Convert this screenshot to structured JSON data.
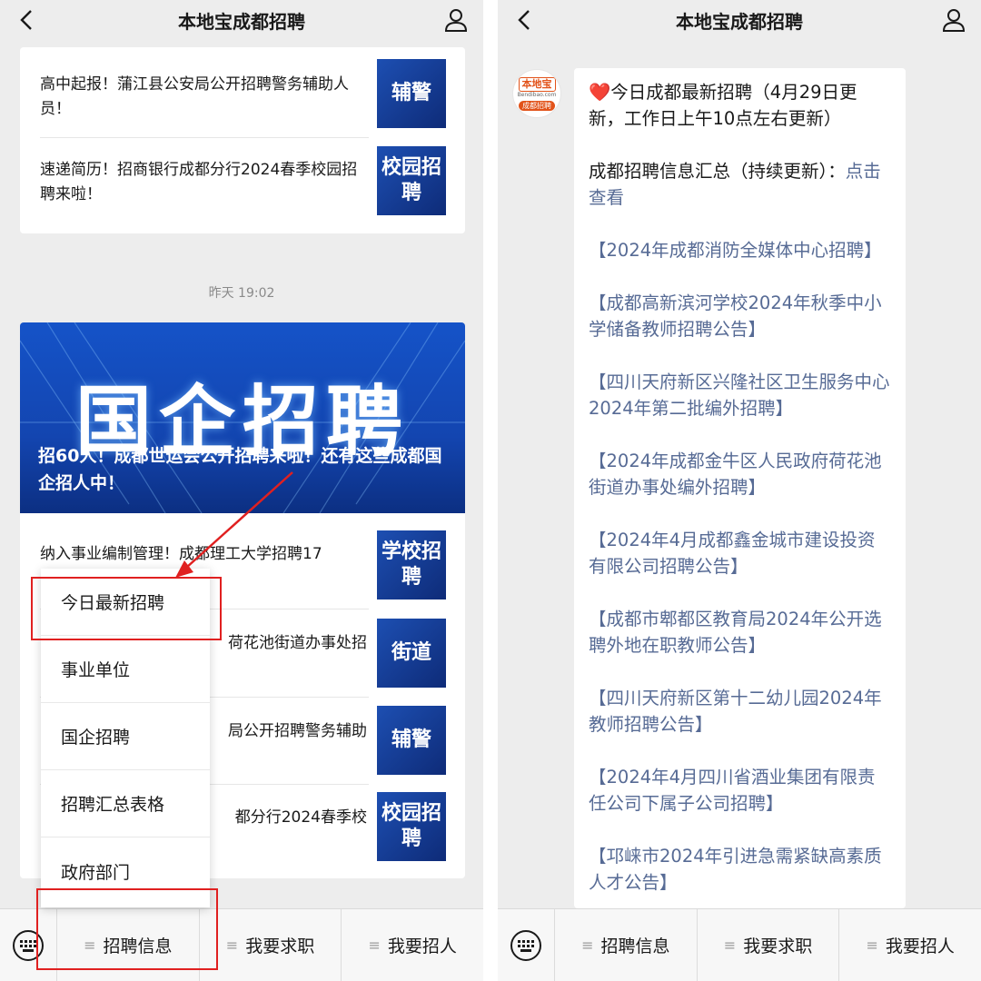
{
  "nav": {
    "title": "本地宝成都招聘"
  },
  "left": {
    "top_items": [
      {
        "text": "高中起报！蒲江县公安局公开招聘警务辅助人员！",
        "thumb": "辅警"
      },
      {
        "text": "速递简历！招商银行成都分行2024春季校园招聘来啦！",
        "thumb": "校园招聘"
      }
    ],
    "timestamp": "昨天 19:02",
    "banner": {
      "big_text": "国企招聘",
      "caption": "招60人！成都世运会公开招聘来啦！还有这些成都国企招人中！"
    },
    "list_items": [
      {
        "text": "纳入事业编制管理！成都理工大学招聘17",
        "thumb": "学校招聘"
      },
      {
        "text": "荷花池街道办事处招",
        "thumb": "街道"
      },
      {
        "text": "局公开招聘警务辅助",
        "thumb": "辅警"
      },
      {
        "text": "都分行2024春季校",
        "thumb": "校园招聘"
      }
    ],
    "popup": [
      "今日最新招聘",
      "事业单位",
      "国企招聘",
      "招聘汇总表格",
      "政府部门"
    ]
  },
  "bottom_menu": [
    "招聘信息",
    "我要求职",
    "我要招人"
  ],
  "right": {
    "avatar": {
      "top": "本地宝",
      "mid": "Bendibao.com",
      "bottom": "成都招聘"
    },
    "message": {
      "heart": "❤️",
      "title": "今日成都最新招聘（4月29日更新，工作日上午10点左右更新）",
      "summary_text": "成都招聘信息汇总（持续更新）：",
      "summary_link": "点击查看",
      "links": [
        "【2024年成都消防全媒体中心招聘】",
        "【成都高新滨河学校2024年秋季中小学储备教师招聘公告】",
        "【四川天府新区兴隆社区卫生服务中心2024年第二批编外招聘】",
        "【2024年成都金牛区人民政府荷花池街道办事处编外招聘】",
        "【2024年4月成都鑫金城市建设投资有限公司招聘公告】",
        "【成都市郫都区教育局2024年公开选聘外地在职教师公告】",
        "【四川天府新区第十二幼儿园2024年教师招聘公告】",
        "【2024年4月四川省酒业集团有限责任公司下属子公司招聘】",
        "【邛崃市2024年引进急需紧缺高素质人才公告】"
      ]
    }
  },
  "colors": {
    "highlight": "#e02020",
    "link": "#576b95",
    "banner": "#1553c8",
    "thumb": "#1d4fb2"
  }
}
